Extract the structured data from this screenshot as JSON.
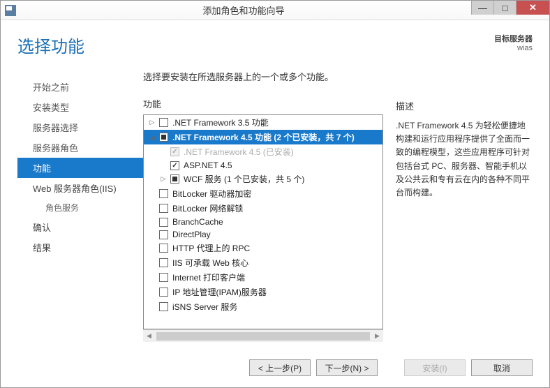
{
  "window": {
    "title": "添加角色和功能向导"
  },
  "header": {
    "heading": "选择功能",
    "target_label": "目标服务器",
    "target_name": "wias"
  },
  "sidebar": {
    "items": [
      {
        "label": "开始之前",
        "active": false
      },
      {
        "label": "安装类型",
        "active": false
      },
      {
        "label": "服务器选择",
        "active": false
      },
      {
        "label": "服务器角色",
        "active": false
      },
      {
        "label": "功能",
        "active": true
      },
      {
        "label": "Web 服务器角色(IIS)",
        "active": false
      },
      {
        "label": "角色服务",
        "active": false,
        "sub": true
      },
      {
        "label": "确认",
        "active": false
      },
      {
        "label": "结果",
        "active": false
      }
    ]
  },
  "main": {
    "instruction": "选择要安装在所选服务器上的一个或多个功能。",
    "features_label": "功能",
    "desc_label": "描述",
    "description": ".NET Framework 4.5 为轻松便捷地构建和运行应用程序提供了全面而一致的编程模型，这些应用程序可针对包括台式 PC、服务器、智能手机以及公共云和专有云在内的各种不同平台而构建。"
  },
  "tree": [
    {
      "label": ".NET Framework 3.5 功能",
      "level": 0,
      "expand": "▷",
      "check": "none",
      "selected": false
    },
    {
      "label": ".NET Framework 4.5 功能 (2 个已安装，共 7 个)",
      "level": 0,
      "expand": "◢",
      "check": "partial",
      "selected": true
    },
    {
      "label": ".NET Framework 4.5 (已安装)",
      "level": 1,
      "expand": "",
      "check": "checked-disabled",
      "selected": false,
      "disabled": true
    },
    {
      "label": "ASP.NET 4.5",
      "level": 1,
      "expand": "",
      "check": "checked",
      "selected": false
    },
    {
      "label": "WCF 服务 (1 个已安装，共 5 个)",
      "level": 1,
      "expand": "▷",
      "check": "partial",
      "selected": false
    },
    {
      "label": "BitLocker 驱动器加密",
      "level": 0,
      "expand": "",
      "check": "none",
      "selected": false
    },
    {
      "label": "BitLocker 网络解锁",
      "level": 0,
      "expand": "",
      "check": "none",
      "selected": false
    },
    {
      "label": "BranchCache",
      "level": 0,
      "expand": "",
      "check": "none",
      "selected": false
    },
    {
      "label": "DirectPlay",
      "level": 0,
      "expand": "",
      "check": "none",
      "selected": false
    },
    {
      "label": "HTTP 代理上的 RPC",
      "level": 0,
      "expand": "",
      "check": "none",
      "selected": false
    },
    {
      "label": "IIS 可承载 Web 核心",
      "level": 0,
      "expand": "",
      "check": "none",
      "selected": false
    },
    {
      "label": "Internet 打印客户端",
      "level": 0,
      "expand": "",
      "check": "none",
      "selected": false
    },
    {
      "label": "IP 地址管理(IPAM)服务器",
      "level": 0,
      "expand": "",
      "check": "none",
      "selected": false
    },
    {
      "label": "iSNS Server 服务",
      "level": 0,
      "expand": "",
      "check": "none",
      "selected": false
    }
  ],
  "footer": {
    "prev": "< 上一步(P)",
    "next": "下一步(N) >",
    "install": "安装(I)",
    "cancel": "取消"
  }
}
